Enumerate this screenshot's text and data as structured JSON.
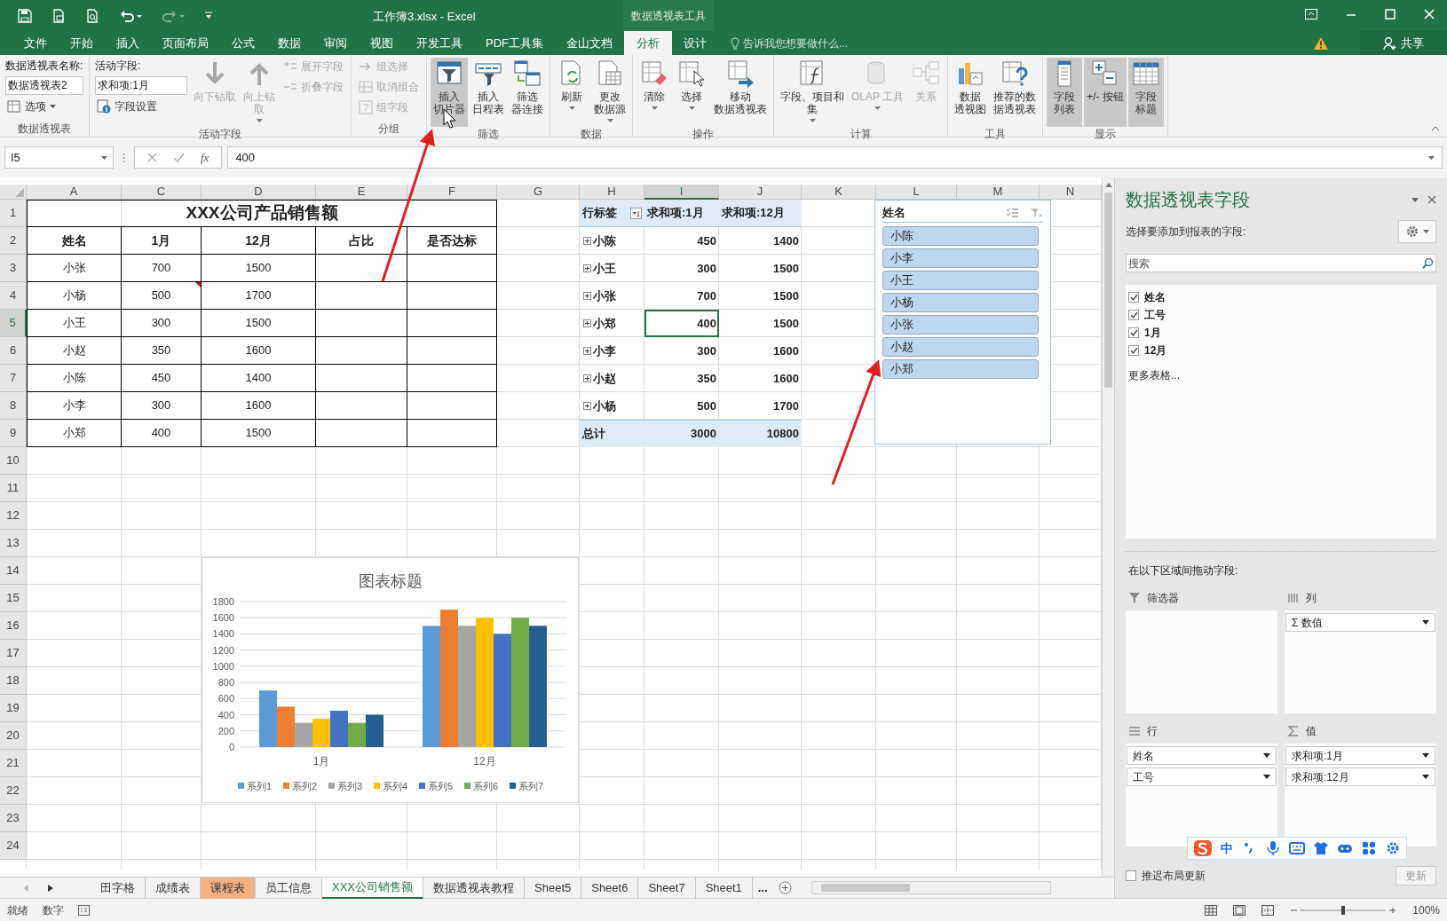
{
  "window": {
    "title": "工作簿3.xlsx - Excel",
    "context_header": "数据透视表工具"
  },
  "ribbon_tabs": [
    {
      "label": "文件",
      "selected": false
    },
    {
      "label": "开始",
      "selected": false
    },
    {
      "label": "插入",
      "selected": false
    },
    {
      "label": "页面布局",
      "selected": false
    },
    {
      "label": "公式",
      "selected": false
    },
    {
      "label": "数据",
      "selected": false
    },
    {
      "label": "审阅",
      "selected": false
    },
    {
      "label": "视图",
      "selected": false
    },
    {
      "label": "开发工具",
      "selected": false
    },
    {
      "label": "PDF工具集",
      "selected": false
    },
    {
      "label": "金山文档",
      "selected": false
    },
    {
      "label": "分析",
      "selected": true
    },
    {
      "label": "设计",
      "selected": false
    }
  ],
  "tell_me": {
    "placeholder": "告诉我您想要做什么..."
  },
  "share": {
    "label": "共享"
  },
  "ribbon": {
    "groups": [
      {
        "label": "数据透视表",
        "columns": [
          {
            "kind": "stack",
            "items": [
              {
                "kind": "caption",
                "label": "数据透视表名称:"
              },
              {
                "kind": "field",
                "value": "数据透视表2"
              },
              {
                "kind": "small",
                "label": "选项",
                "disabled": false,
                "dropdown": true
              }
            ]
          }
        ]
      },
      {
        "label": "活动字段",
        "columns": [
          {
            "kind": "stack",
            "items": [
              {
                "kind": "caption",
                "label": "活动字段:"
              },
              {
                "kind": "field",
                "value": "求和项:1月"
              },
              {
                "kind": "small",
                "label": "字段设置",
                "disabled": false,
                "dropdown": false
              }
            ]
          },
          {
            "kind": "large",
            "lines": [
              "向下钻取"
            ],
            "disabled": true,
            "highlighted": false,
            "dropdown": false
          },
          {
            "kind": "large",
            "lines": [
              "向上钻",
              "取"
            ],
            "disabled": true,
            "highlighted": false,
            "dropdown": true
          },
          {
            "kind": "stack",
            "items": [
              {
                "kind": "small",
                "label": "展开字段",
                "disabled": true,
                "dropdown": false
              },
              {
                "kind": "small",
                "label": "折叠字段",
                "disabled": true,
                "dropdown": false
              }
            ]
          }
        ]
      },
      {
        "label": "分组",
        "columns": [
          {
            "kind": "stack",
            "items": [
              {
                "kind": "small",
                "label": "组选择",
                "disabled": true,
                "dropdown": false
              },
              {
                "kind": "small",
                "label": "取消组合",
                "disabled": true,
                "dropdown": false
              },
              {
                "kind": "small",
                "label": "组字段",
                "disabled": true,
                "dropdown": false
              }
            ]
          }
        ]
      },
      {
        "label": "筛选",
        "columns": [
          {
            "kind": "large",
            "lines": [
              "插入",
              "切片器"
            ],
            "disabled": false,
            "highlighted": true,
            "dropdown": false
          },
          {
            "kind": "large",
            "lines": [
              "插入",
              "日程表"
            ],
            "disabled": false,
            "highlighted": false,
            "dropdown": false
          },
          {
            "kind": "large",
            "lines": [
              "筛选",
              "器连接"
            ],
            "disabled": false,
            "highlighted": false,
            "dropdown": false
          }
        ]
      },
      {
        "label": "数据",
        "columns": [
          {
            "kind": "large",
            "lines": [
              "刷新"
            ],
            "disabled": false,
            "highlighted": false,
            "dropdown": true
          },
          {
            "kind": "large",
            "lines": [
              "更改",
              "数据源"
            ],
            "disabled": false,
            "highlighted": false,
            "dropdown": true
          }
        ]
      },
      {
        "label": "操作",
        "columns": [
          {
            "kind": "large",
            "lines": [
              "清除"
            ],
            "disabled": false,
            "highlighted": false,
            "dropdown": true
          },
          {
            "kind": "large",
            "lines": [
              "选择"
            ],
            "disabled": false,
            "highlighted": false,
            "dropdown": true
          },
          {
            "kind": "large",
            "lines": [
              "移动",
              "数据透视表"
            ],
            "disabled": false,
            "highlighted": false,
            "dropdown": false
          }
        ]
      },
      {
        "label": "计算",
        "columns": [
          {
            "kind": "large",
            "lines": [
              "字段、项目和",
              "集"
            ],
            "disabled": false,
            "highlighted": false,
            "dropdown": true
          },
          {
            "kind": "large",
            "lines": [
              "OLAP 工具"
            ],
            "disabled": true,
            "highlighted": false,
            "dropdown": true
          },
          {
            "kind": "large",
            "lines": [
              "关系"
            ],
            "disabled": true,
            "highlighted": false,
            "dropdown": false
          }
        ]
      },
      {
        "label": "工具",
        "columns": [
          {
            "kind": "large",
            "lines": [
              "数据",
              "透视图"
            ],
            "disabled": false,
            "highlighted": false,
            "dropdown": false
          },
          {
            "kind": "large",
            "lines": [
              "推荐的数",
              "据透视表"
            ],
            "disabled": false,
            "highlighted": false,
            "dropdown": false
          }
        ]
      },
      {
        "label": "显示",
        "columns": [
          {
            "kind": "large",
            "lines": [
              "字段",
              "列表"
            ],
            "disabled": false,
            "highlighted": true,
            "dropdown": false
          },
          {
            "kind": "large",
            "lines": [
              "+/- 按钮"
            ],
            "disabled": false,
            "highlighted": true,
            "dropdown": false
          },
          {
            "kind": "large",
            "lines": [
              "字段",
              "标题"
            ],
            "disabled": false,
            "highlighted": true,
            "dropdown": false
          }
        ]
      }
    ]
  },
  "formula_bar": {
    "name_box": "I5",
    "function_label": "fx",
    "value": "400"
  },
  "sheet": {
    "columns": [
      {
        "label": "A",
        "selected": false
      },
      {
        "label": "C",
        "selected": false
      },
      {
        "label": "D",
        "selected": false
      },
      {
        "label": "E",
        "selected": false
      },
      {
        "label": "F",
        "selected": false
      },
      {
        "label": "G",
        "selected": false
      },
      {
        "label": "H",
        "selected": false
      },
      {
        "label": "I",
        "selected": true
      },
      {
        "label": "J",
        "selected": false
      },
      {
        "label": "K",
        "selected": false
      },
      {
        "label": "L",
        "selected": false
      },
      {
        "label": "M",
        "selected": false
      },
      {
        "label": "N",
        "selected": false
      }
    ],
    "rows": [
      {
        "label": "1",
        "selected": false
      },
      {
        "label": "2",
        "selected": false
      },
      {
        "label": "3",
        "selected": false
      },
      {
        "label": "4",
        "selected": false
      },
      {
        "label": "5",
        "selected": true
      },
      {
        "label": "6",
        "selected": false
      },
      {
        "label": "7",
        "selected": false
      },
      {
        "label": "8",
        "selected": false
      },
      {
        "label": "9",
        "selected": false
      },
      {
        "label": "10",
        "selected": false
      },
      {
        "label": "11",
        "selected": false
      },
      {
        "label": "12",
        "selected": false
      },
      {
        "label": "13",
        "selected": false
      },
      {
        "label": "14",
        "selected": false
      },
      {
        "label": "15",
        "selected": false
      },
      {
        "label": "16",
        "selected": false
      },
      {
        "label": "17",
        "selected": false
      },
      {
        "label": "18",
        "selected": false
      },
      {
        "label": "19",
        "selected": false
      },
      {
        "label": "20",
        "selected": false
      },
      {
        "label": "21",
        "selected": false
      },
      {
        "label": "22",
        "selected": false
      },
      {
        "label": "23",
        "selected": false
      },
      {
        "label": "24",
        "selected": false
      }
    ],
    "sales_table": {
      "title": "XXX公司产品销售额",
      "headers": [
        "姓名",
        "1月",
        "12月",
        "占比",
        "是否达标"
      ],
      "rows": [
        {
          "name": "小张",
          "jan": "700",
          "dec": "1500",
          "comment": false
        },
        {
          "name": "小杨",
          "jan": "500",
          "dec": "1700",
          "comment": true
        },
        {
          "name": "小王",
          "jan": "300",
          "dec": "1500",
          "comment": false
        },
        {
          "name": "小赵",
          "jan": "350",
          "dec": "1600",
          "comment": false
        },
        {
          "name": "小陈",
          "jan": "450",
          "dec": "1400",
          "comment": false
        },
        {
          "name": "小李",
          "jan": "300",
          "dec": "1600",
          "comment": false
        },
        {
          "name": "小郑",
          "jan": "400",
          "dec": "1500",
          "comment": false
        }
      ]
    },
    "pivot_table": {
      "headers": [
        "行标签",
        "求和项:1月",
        "求和项:12月"
      ],
      "rows": [
        {
          "label": "小陈",
          "jan": "450",
          "dec": "1400",
          "selected": false
        },
        {
          "label": "小王",
          "jan": "300",
          "dec": "1500",
          "selected": false
        },
        {
          "label": "小张",
          "jan": "700",
          "dec": "1500",
          "selected": false
        },
        {
          "label": "小郑",
          "jan": "400",
          "dec": "1500",
          "selected": true
        },
        {
          "label": "小李",
          "jan": "300",
          "dec": "1600",
          "selected": false
        },
        {
          "label": "小赵",
          "jan": "350",
          "dec": "1600",
          "selected": false
        },
        {
          "label": "小杨",
          "jan": "500",
          "dec": "1700",
          "selected": false
        }
      ],
      "total": {
        "label": "总计",
        "jan": "3000",
        "dec": "10800"
      }
    },
    "slicer": {
      "title": "姓名",
      "items": [
        {
          "label": "小陈",
          "selected": true
        },
        {
          "label": "小李",
          "selected": true
        },
        {
          "label": "小王",
          "selected": true
        },
        {
          "label": "小杨",
          "selected": true
        },
        {
          "label": "小张",
          "selected": true
        },
        {
          "label": "小赵",
          "selected": true
        },
        {
          "label": "小郑",
          "selected": true
        }
      ]
    },
    "chart": {
      "chart_data": {
        "type": "bar",
        "title": "图表标题",
        "categories": [
          "1月",
          "12月"
        ],
        "series": [
          {
            "name": "系列1",
            "color": "#5b9bd5",
            "values": [
              700,
              1500
            ]
          },
          {
            "name": "系列2",
            "color": "#ed7d31",
            "values": [
              500,
              1700
            ]
          },
          {
            "name": "系列3",
            "color": "#a5a5a5",
            "values": [
              300,
              1500
            ]
          },
          {
            "name": "系列4",
            "color": "#ffc000",
            "values": [
              350,
              1600
            ]
          },
          {
            "name": "系列5",
            "color": "#4472c4",
            "values": [
              450,
              1400
            ]
          },
          {
            "name": "系列6",
            "color": "#70ad47",
            "values": [
              300,
              1600
            ]
          },
          {
            "name": "系列7",
            "color": "#255e91",
            "values": [
              400,
              1500
            ]
          }
        ],
        "grid": true,
        "legend": "bottom",
        "ylim": [
          0,
          1800
        ],
        "yticks": [
          0,
          200,
          400,
          600,
          800,
          1000,
          1200,
          1400,
          1600,
          1800
        ]
      }
    }
  },
  "sheet_tabs": [
    {
      "label": "田字格",
      "selected": false
    },
    {
      "label": "成绩表",
      "selected": false
    },
    {
      "label": "课程表",
      "selected": false,
      "color": "#f4b183"
    },
    {
      "label": "员工信息",
      "selected": false
    },
    {
      "label": "XXX公司销售额",
      "selected": true
    },
    {
      "label": "数据透视表教程",
      "selected": false
    },
    {
      "label": "Sheet5",
      "selected": false
    },
    {
      "label": "Sheet6",
      "selected": false
    },
    {
      "label": "Sheet7",
      "selected": false
    },
    {
      "label": "Sheet1",
      "selected": false
    }
  ],
  "sheet_tabs_more": "...",
  "field_pane": {
    "title": "数据透视表字段",
    "subtitle": "选择要添加到报表的字段:",
    "search": {
      "placeholder": "搜索"
    },
    "fields": [
      {
        "label": "姓名",
        "checked": true
      },
      {
        "label": "工号",
        "checked": true
      },
      {
        "label": "1月",
        "checked": true
      },
      {
        "label": "12月",
        "checked": true
      }
    ],
    "more_tables": "更多表格...",
    "areas_caption": "在以下区域间拖动字段:",
    "areas": [
      {
        "kind": "filter",
        "label": "筛选器"
      },
      {
        "kind": "columns",
        "label": "列",
        "items": [
          "Σ 数值"
        ]
      },
      {
        "kind": "rows",
        "label": "行",
        "items": [
          "姓名",
          "工号"
        ]
      },
      {
        "kind": "values",
        "label": "值",
        "items": [
          "求和项:1月",
          "求和项:12月"
        ]
      }
    ],
    "defer_update": {
      "label": "推迟布局更新",
      "checked": false
    },
    "update_button": "更新"
  },
  "ime_toolbar": {
    "mode": "中"
  },
  "status_bar": {
    "items": [
      "就绪",
      "数字"
    ],
    "zoom": "100%"
  }
}
